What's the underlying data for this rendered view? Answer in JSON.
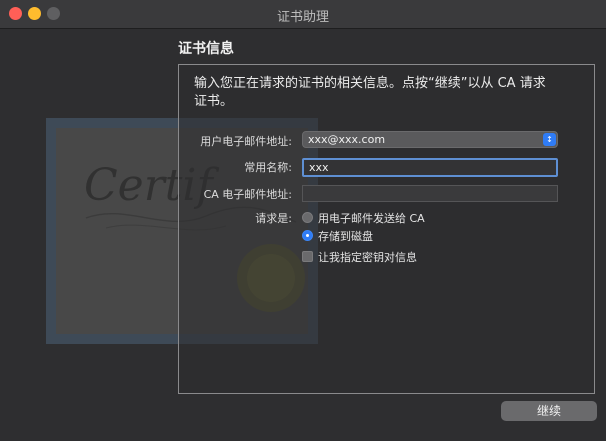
{
  "window": {
    "title": "证书助理"
  },
  "section_title": "证书信息",
  "intro_text_line1": "输入您正在请求的证书的相关信息。点按“继续”以从 CA 请求",
  "intro_text_line2": "证书。",
  "form": {
    "email_label": "用户电子邮件地址:",
    "email_value": "xxx@xxx.com",
    "common_name_label": "常用名称:",
    "common_name_value": "xxx",
    "ca_email_label": "CA 电子邮件地址:",
    "ca_email_value": "",
    "request_label": "请求是:",
    "option_email_ca": "用电子邮件发送给 CA",
    "option_save_disk": "存储到磁盘",
    "option_let_me_specify": "让我指定密钥对信息"
  },
  "buttons": {
    "continue": "继续"
  },
  "colors": {
    "accent": "#2f7cf6",
    "focus_ring": "#5e8fd3"
  },
  "icons": {
    "select_arrow": "chevron-up-down-icon"
  }
}
